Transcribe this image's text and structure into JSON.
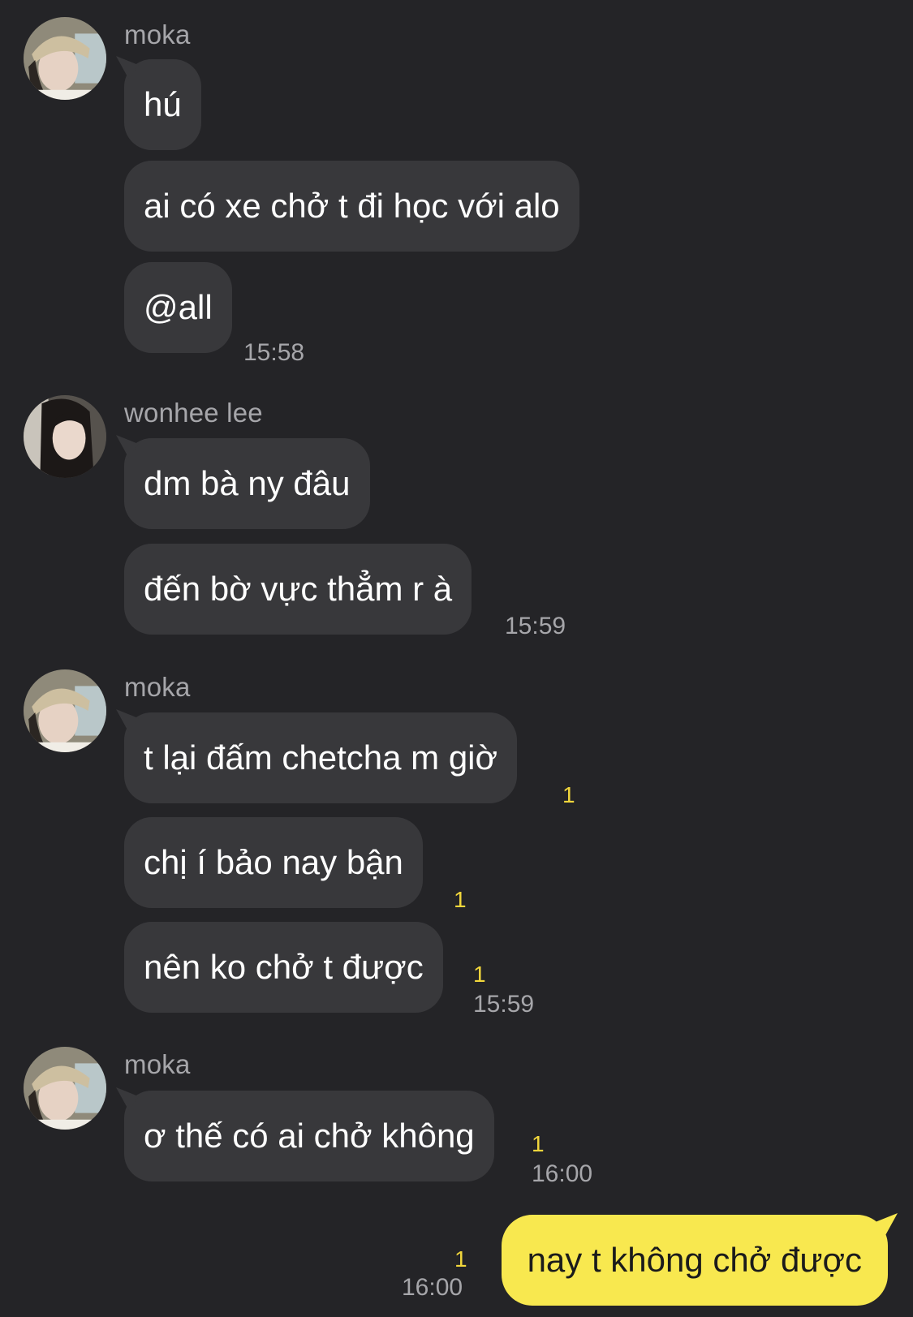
{
  "groups": [
    {
      "sender": "moka",
      "avatar": "avatar-moka-icon",
      "messages": [
        {
          "text": "hú"
        },
        {
          "text": "ai có xe chở t đi học với alo"
        },
        {
          "text": "@all"
        }
      ],
      "time": "15:58"
    },
    {
      "sender": "wonhee lee",
      "avatar": "avatar-wonhee-icon",
      "messages": [
        {
          "text": "dm bà ny đâu"
        },
        {
          "text": "đến bờ vực thẳm r à"
        }
      ],
      "time": "15:59"
    },
    {
      "sender": "moka",
      "avatar": "avatar-moka-icon",
      "messages": [
        {
          "text": "t lại đấm chetcha m giờ",
          "unread": "1"
        },
        {
          "text": "chị í bảo nay bận",
          "unread": "1"
        },
        {
          "text": "nên ko chở t được",
          "unread": "1"
        }
      ],
      "time": "15:59"
    },
    {
      "sender": "moka",
      "avatar": "avatar-moka-icon",
      "messages": [
        {
          "text": "ơ thế có ai chở không",
          "unread": "1"
        }
      ],
      "time": "16:00"
    }
  ],
  "my_message": {
    "text": "nay t không chở được",
    "unread": "1",
    "time": "16:00"
  },
  "colors": {
    "background": "#242427",
    "other_bubble": "#38383b",
    "my_bubble": "#f8e84f",
    "unread_count": "#f2d73c",
    "meta_text": "#a6a6aa"
  }
}
